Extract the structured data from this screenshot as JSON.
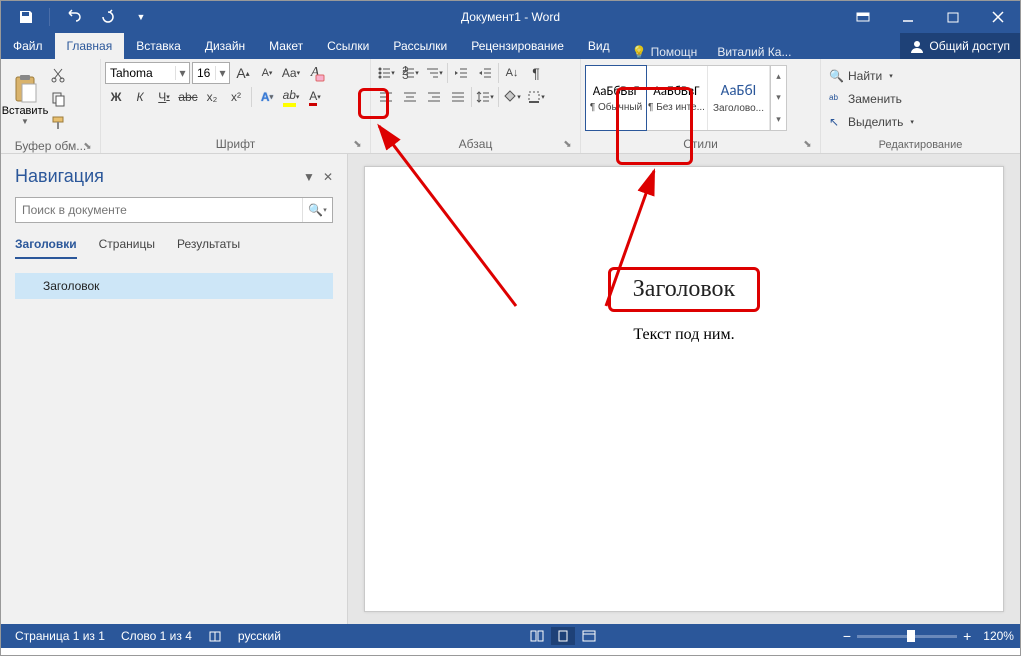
{
  "titlebar": {
    "title": "Документ1 - Word"
  },
  "tabs": {
    "file": "Файл",
    "home": "Главная",
    "insert": "Вставка",
    "design": "Дизайн",
    "layout": "Макет",
    "references": "Ссылки",
    "mailings": "Рассылки",
    "review": "Рецензирование",
    "view": "Вид",
    "tell": "Помощн",
    "user": "Виталий Ка...",
    "share": "Общий доступ"
  },
  "ribbon": {
    "clipboard": {
      "label": "Буфер обм...",
      "paste": "Вставить"
    },
    "font": {
      "label": "Шрифт",
      "name": "Tahoma",
      "size": "16",
      "bold": "Ж",
      "italic": "К",
      "underline": "Ч",
      "strike": "abc",
      "sub": "x₂",
      "sup": "x²",
      "case": "Aa",
      "grow": "A",
      "shrink": "A"
    },
    "paragraph": {
      "label": "Абзац"
    },
    "styles": {
      "label": "Стили",
      "items": [
        {
          "preview": "АаБбВвГ",
          "name": "¶ Обычный"
        },
        {
          "preview": "АаБбВвГ",
          "name": "¶ Без инте..."
        },
        {
          "preview": "АаБбІ",
          "name": "Заголово..."
        }
      ]
    },
    "editing": {
      "label": "Редактирование",
      "find": "Найти",
      "replace": "Заменить",
      "select": "Выделить"
    }
  },
  "nav": {
    "title": "Навигация",
    "search_placeholder": "Поиск в документе",
    "tabs": {
      "headings": "Заголовки",
      "pages": "Страницы",
      "results": "Результаты"
    },
    "items": [
      "Заголовок"
    ]
  },
  "document": {
    "heading": "Заголовок",
    "body": "Текст под ним."
  },
  "status": {
    "page": "Страница 1 из 1",
    "words": "Слово 1 из 4",
    "lang": "русский",
    "zoom": "120%"
  }
}
